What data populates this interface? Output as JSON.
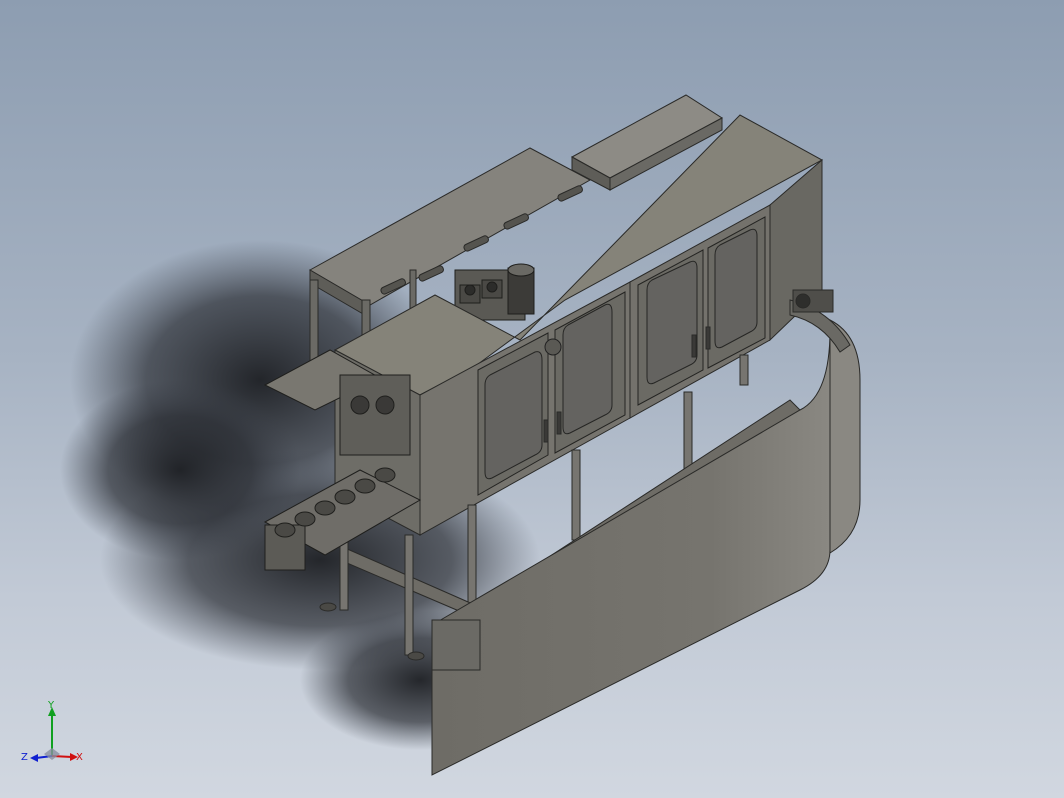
{
  "viewport": {
    "background_top": "#8d9db1",
    "background_bottom": "#d1d7e0",
    "model_color": "#7a7872",
    "model_dark": "#55544f",
    "edge_color": "#2a2a28"
  },
  "triad": {
    "x_label": "X",
    "y_label": "Y",
    "z_label": "Z",
    "x_color": "#d01010",
    "y_color": "#10a020",
    "z_color": "#1020d0"
  }
}
